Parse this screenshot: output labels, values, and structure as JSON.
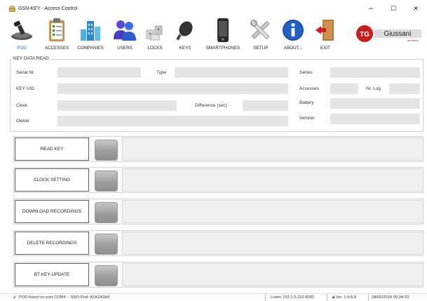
{
  "window": {
    "title": "GSN-KEY - Access Control",
    "controls": {
      "minimize": "–",
      "maximize": "☐",
      "close": "✕"
    }
  },
  "toolbar": {
    "items": [
      {
        "label": "POD",
        "icon": "pod-reader-icon",
        "active": true
      },
      {
        "label": "ACCESSES",
        "icon": "clipboard-icon"
      },
      {
        "label": "COMPANIES",
        "icon": "buildings-icon"
      },
      {
        "label": "USERS",
        "icon": "users-icon"
      },
      {
        "label": "LOCKS",
        "icon": "locks-icon"
      },
      {
        "label": "KEYS",
        "icon": "key-icon"
      },
      {
        "label": "SMARTPHONES",
        "icon": "smartphone-icon"
      },
      {
        "label": "SETUP",
        "icon": "tools-icon"
      },
      {
        "label": "ABOUT...",
        "icon": "info-icon"
      },
      {
        "label": "EXIT",
        "icon": "exit-door-icon"
      }
    ],
    "brand": {
      "logo_text": "Giussani",
      "tagline": "serrature",
      "monogram": "TG"
    }
  },
  "key_data": {
    "title": "KEY DATA READ",
    "serial_label": "Serial Nr.",
    "type_label": "Type",
    "series_label": "Series",
    "uid_label": "KEY UID",
    "accesses_label": "Accesses",
    "nrlog_label": "Nr. Log",
    "clock_label": "Clock",
    "difference_label": "Difference (sec)",
    "battery_label": "Battery",
    "owner_label": "Owner",
    "version_label": "Version",
    "values": {
      "serial": "",
      "type": "",
      "series": "",
      "uid": "",
      "accesses": "",
      "nrlog": "",
      "clock": "",
      "difference": "",
      "battery": "",
      "owner": "",
      "version": ""
    }
  },
  "operations": [
    {
      "label": "READ KEY",
      "output": ""
    },
    {
      "label": "CLOCK SETTING",
      "output": ""
    },
    {
      "label": "DOWNLOAD RECORDINGS",
      "output": ""
    },
    {
      "label": "DELETE RECORDINGS",
      "output": ""
    },
    {
      "label": "BT KEY UPDATE",
      "output": ""
    }
  ],
  "status": {
    "pod": "POD found on port COM4 -- SNO Pod: A1A2A3A4",
    "listen": "Listen 192.1.5.215:8282",
    "version": "Ver. 1.4.8.8",
    "datetime": "28/05/2019 09:34:03"
  },
  "colors": {
    "accent": "#2a73c8",
    "led": "#a3a3a3",
    "field": "#e4e4e4"
  }
}
